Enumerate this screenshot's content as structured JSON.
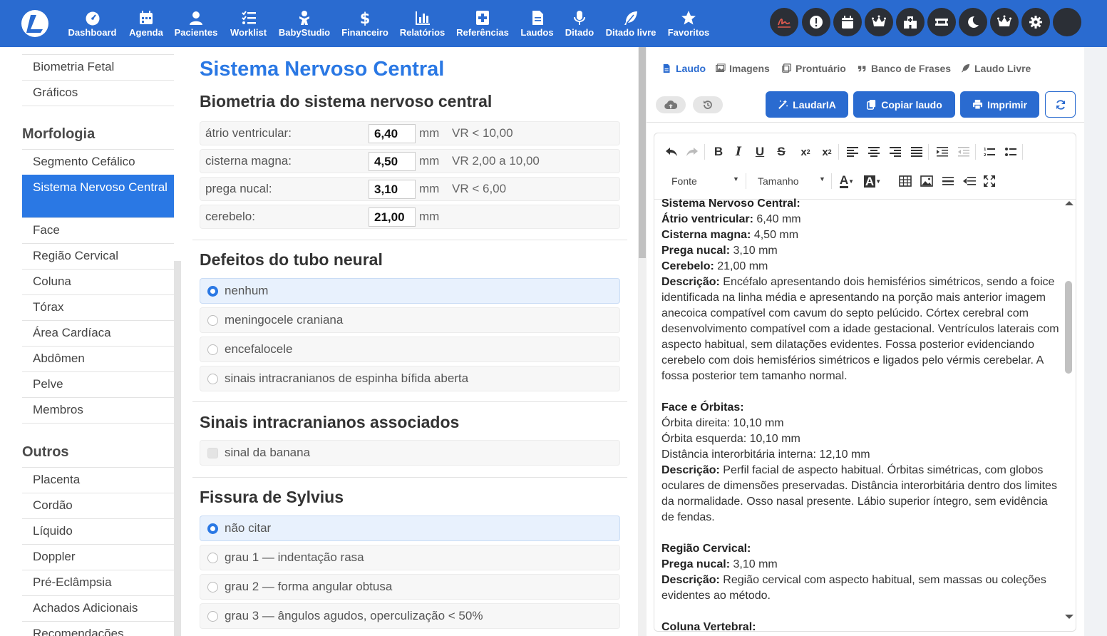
{
  "nav": [
    {
      "icon": "dashboard-gauge-icon",
      "label": "Dashboard"
    },
    {
      "icon": "calendar-icon",
      "label": "Agenda"
    },
    {
      "icon": "user-icon",
      "label": "Pacientes"
    },
    {
      "icon": "list-check-icon",
      "label": "Worklist"
    },
    {
      "icon": "baby-icon",
      "label": "BabyStudio"
    },
    {
      "icon": "dollar-icon",
      "label": "Financeiro"
    },
    {
      "icon": "bar-chart-icon",
      "label": "Relatórios"
    },
    {
      "icon": "book-medical-icon",
      "label": "Referências"
    },
    {
      "icon": "file-icon",
      "label": "Laudos"
    },
    {
      "icon": "microphone-icon",
      "label": "Ditado"
    },
    {
      "icon": "feather-icon",
      "label": "Ditado livre"
    },
    {
      "icon": "star-icon",
      "label": "Favoritos"
    }
  ],
  "sidebar": {
    "top_items": [
      "Biometria Fetal",
      "Gráficos"
    ],
    "morfologia_heading": "Morfologia",
    "morfologia_items": [
      "Segmento Cefálico",
      "Sistema Nervoso Central",
      "Face",
      "Região Cervical",
      "Coluna",
      "Tórax",
      "Área Cardíaca",
      "Abdômen",
      "Pelve",
      "Membros"
    ],
    "outros_heading": "Outros",
    "outros_items": [
      "Placenta",
      "Cordão",
      "Líquido",
      "Doppler",
      "Pré-Eclâmpsia",
      "Achados Adicionais",
      "Recomendações"
    ]
  },
  "form": {
    "title": "Sistema Nervoso Central",
    "biometria": {
      "heading": "Biometria do sistema nervoso central",
      "rows": [
        {
          "label": "átrio ventricular:",
          "value": "6,40",
          "unit": "mm",
          "vr": "VR < 10,00"
        },
        {
          "label": "cisterna magna:",
          "value": "4,50",
          "unit": "mm",
          "vr": "VR 2,00 a 10,00"
        },
        {
          "label": "prega nucal:",
          "value": "3,10",
          "unit": "mm",
          "vr": "VR < 6,00"
        },
        {
          "label": "cerebelo:",
          "value": "21,00",
          "unit": "mm",
          "vr": ""
        }
      ]
    },
    "defeitos": {
      "heading": "Defeitos do tubo neural",
      "options": [
        "nenhum",
        "meningocele craniana",
        "encefalocele",
        "sinais intracranianos de espinha bífida aberta"
      ],
      "selected": "nenhum"
    },
    "sinais": {
      "heading": "Sinais intracranianos associados",
      "options": [
        "sinal da banana"
      ]
    },
    "sylvius": {
      "heading": "Fissura de Sylvius",
      "options": [
        "não citar",
        "grau 1 — indentação rasa",
        "grau 2 — forma angular obtusa",
        "grau 3 — ângulos agudos, operculização < 50%"
      ],
      "selected": "não citar"
    }
  },
  "tabs": [
    "Laudo",
    "Imagens",
    "Prontuário",
    "Banco de Frases",
    "Laudo Livre"
  ],
  "active_tab": "Laudo",
  "actions": {
    "laudaria": "LaudarIA",
    "copiar": "Copiar laudo",
    "imprimir": "Imprimir"
  },
  "editor": {
    "font_label": "Fonte",
    "size_label": "Tamanho",
    "paragraphs": [
      [
        {
          "b": "Sistema Nervoso Central:"
        }
      ],
      [
        {
          "b": "Átrio ventricular:"
        },
        {
          "t": " 6,40 mm"
        }
      ],
      [
        {
          "b": "Cisterna magna:"
        },
        {
          "t": " 4,50 mm"
        }
      ],
      [
        {
          "b": "Prega nucal:"
        },
        {
          "t": " 3,10 mm"
        }
      ],
      [
        {
          "b": "Cerebelo:"
        },
        {
          "t": " 21,00 mm"
        }
      ],
      [
        {
          "b": "Descrição:"
        },
        {
          "t": " Encéfalo apresentando dois hemisférios simétricos, sendo a foice identificada na linha média e apresentando na porção mais anterior imagem anecoica compatível com cavum do septo pelúcido. Córtex cerebral com desenvolvimento compatível com a idade gestacional. Ventrículos laterais com aspecto habitual, sem dilatações evidentes. Fossa posterior evidenciando cerebelo com dois hemisférios simétricos e ligados pelo vérmis cerebelar. A fossa posterior tem tamanho normal."
        }
      ],
      [],
      [
        {
          "b": "Face e Órbitas:"
        }
      ],
      [
        {
          "t": "Órbita direita: 10,10 mm"
        }
      ],
      [
        {
          "t": "Órbita esquerda: 10,10 mm"
        }
      ],
      [
        {
          "t": "Distância interorbitária interna: 12,10 mm"
        }
      ],
      [
        {
          "b": "Descrição:"
        },
        {
          "t": " Perfil facial de aspecto habitual. Órbitas simétricas, com globos oculares de dimensões preservadas. Distância interorbitária dentro dos limites da normalidade. Osso nasal presente. Lábio superior íntegro, sem evidência de fendas."
        }
      ],
      [],
      [
        {
          "b": "Região Cervical:"
        }
      ],
      [
        {
          "b": "Prega nucal:"
        },
        {
          "t": " 3,10 mm"
        }
      ],
      [
        {
          "b": "Descrição:"
        },
        {
          "t": " Região cervical com aspecto habitual, sem massas ou coleções evidentes ao método."
        }
      ],
      [],
      [
        {
          "b": "Coluna Vertebral:"
        }
      ]
    ]
  },
  "colors": {
    "brand": "#2a6bd0",
    "accent": "#2a78e4",
    "dark_button": "#2b2f36",
    "pdf_red": "#e05a4f"
  }
}
